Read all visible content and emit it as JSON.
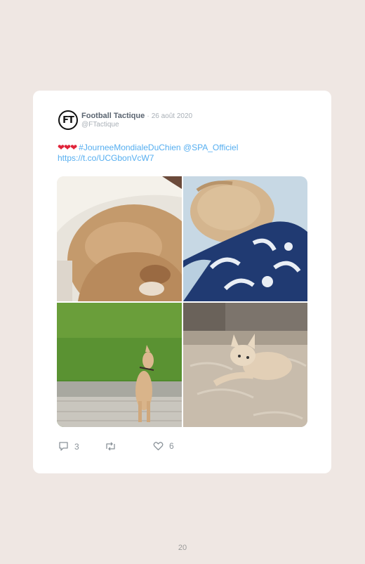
{
  "tweet": {
    "avatar_initials": "FT",
    "author_name": "Football Tactique",
    "separator": "·",
    "date": "26 août 2020",
    "handle": "@FTactique",
    "hearts": "❤❤❤",
    "hashtag": "#JourneeMondialeDuChien",
    "mention": "@SPA_Officiel",
    "link": "https://t.co/UCGbonVcW7",
    "photos": [
      {
        "icon": "dog-sleeping-closeup-photo"
      },
      {
        "icon": "dog-sleeping-on-bed-photo"
      },
      {
        "icon": "dog-on-grass-photo"
      },
      {
        "icon": "dog-lying-on-bedspread-photo"
      }
    ],
    "actions": {
      "reply_count": "3",
      "retweet_count": "",
      "like_count": "6"
    }
  },
  "page_number": "20",
  "colors": {
    "background": "#efe7e3",
    "card": "#ffffff",
    "link": "#55aef0",
    "heart": "#e0243a",
    "muted": "#a9b0b7"
  }
}
